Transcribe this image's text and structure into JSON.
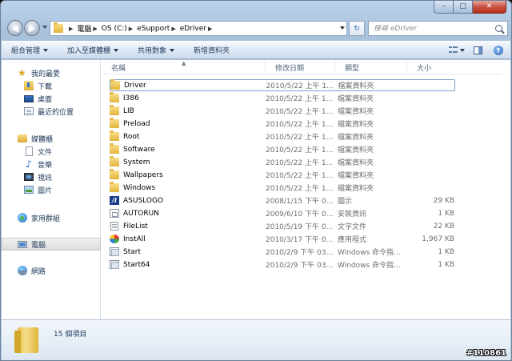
{
  "window": {
    "caption": {
      "minimize": "–",
      "maximize": "□",
      "close": "✕"
    }
  },
  "nav": {
    "back_glyph": "◀",
    "forward_glyph": "▶",
    "breadcrumb": [
      "電腦",
      "OS (C:)",
      "eSupport",
      "eDriver"
    ],
    "refresh_glyph": "↻",
    "search_placeholder": "搜尋 eDriver"
  },
  "commands": {
    "organize": "組合管理",
    "include_library": "加入至媒體櫃",
    "share_with": "共用對象",
    "new_folder": "新增資料夾",
    "help": "?"
  },
  "sidebar": {
    "favorites": {
      "label": "我的最愛",
      "items": [
        "下載",
        "桌面",
        "最近的位置"
      ]
    },
    "libraries": {
      "label": "媒體櫃",
      "items": [
        "文件",
        "音樂",
        "視訊",
        "圖片"
      ]
    },
    "homegroup": "家用群組",
    "computer": "電腦",
    "network": "網路"
  },
  "columns": {
    "name": "名稱",
    "date": "修改日期",
    "type": "類型",
    "size": "大小"
  },
  "files": [
    {
      "name": "Driver",
      "date": "2010/5/22 上午 1...",
      "type": "檔案資料夾",
      "size": "",
      "icon": "folder"
    },
    {
      "name": "I386",
      "date": "2010/5/22 上午 1...",
      "type": "檔案資料夾",
      "size": "",
      "icon": "folder"
    },
    {
      "name": "LIB",
      "date": "2010/5/22 上午 1...",
      "type": "檔案資料夾",
      "size": "",
      "icon": "folder"
    },
    {
      "name": "Preload",
      "date": "2010/5/22 上午 1...",
      "type": "檔案資料夾",
      "size": "",
      "icon": "folder"
    },
    {
      "name": "Root",
      "date": "2010/5/22 上午 1...",
      "type": "檔案資料夾",
      "size": "",
      "icon": "folder"
    },
    {
      "name": "Software",
      "date": "2010/5/22 上午 1...",
      "type": "檔案資料夾",
      "size": "",
      "icon": "folder"
    },
    {
      "name": "System",
      "date": "2010/5/22 上午 1...",
      "type": "檔案資料夾",
      "size": "",
      "icon": "folder"
    },
    {
      "name": "Wallpapers",
      "date": "2010/5/22 上午 1...",
      "type": "檔案資料夾",
      "size": "",
      "icon": "folder"
    },
    {
      "name": "Windows",
      "date": "2010/5/22 上午 1...",
      "type": "檔案資料夾",
      "size": "",
      "icon": "folder"
    },
    {
      "name": "ASUSLOGO",
      "date": "2008/1/15 下午 0...",
      "type": "圖示",
      "size": "29 KB",
      "icon": "asus"
    },
    {
      "name": "AUTORUN",
      "date": "2009/6/10 下午 0...",
      "type": "安裝資訊",
      "size": "1 KB",
      "icon": "inf"
    },
    {
      "name": "FileList",
      "date": "2010/5/19 下午 0...",
      "type": "文字文件",
      "size": "22 KB",
      "icon": "txt"
    },
    {
      "name": "InstAll",
      "date": "2010/3/17 下午 0...",
      "type": "應用程式",
      "size": "1,967 KB",
      "icon": "install"
    },
    {
      "name": "Start",
      "date": "2010/2/9 下午 03...",
      "type": "Windows 命令指...",
      "size": "1 KB",
      "icon": "cmd"
    },
    {
      "name": "Start64",
      "date": "2010/2/9 下午 03...",
      "type": "Windows 命令指...",
      "size": "1 KB",
      "icon": "cmd"
    }
  ],
  "status": {
    "count": "15 個項目"
  },
  "watermark": "#110861"
}
